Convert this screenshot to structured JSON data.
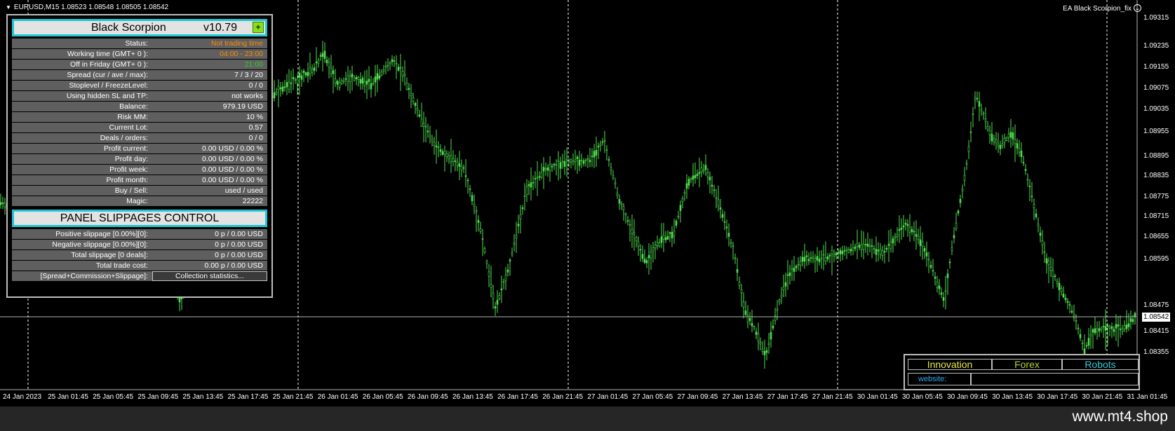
{
  "window": {
    "symbol_line": "EURUSD,M15  1.08523 1.08548 1.08505 1.08542",
    "ea_label": "EA Black Scorpion_fix",
    "smile_icon": "smile-icon"
  },
  "colors": {
    "candle": "#4fe04f",
    "grid": "#ffffff",
    "background": "#000000",
    "panel_accent": "#1fc6d6",
    "orange": "#ff8c00",
    "green": "#2fcf2f"
  },
  "chart": {
    "price_ticks": [
      "1.09315",
      "1.09235",
      "1.09155",
      "1.09075",
      "1.09035",
      "1.08955",
      "1.08895",
      "1.08835",
      "1.08775",
      "1.08715",
      "1.08655",
      "1.08595",
      "1.08542",
      "1.08475",
      "1.08415",
      "1.08355"
    ],
    "current_price": "1.08542",
    "time_ticks": [
      "24 Jan 2023",
      "25 Jan 01:45",
      "25 Jan 05:45",
      "25 Jan 09:45",
      "25 Jan 13:45",
      "25 Jan 17:45",
      "25 Jan 21:45",
      "26 Jan 01:45",
      "26 Jan 05:45",
      "26 Jan 09:45",
      "26 Jan 13:45",
      "26 Jan 17:45",
      "26 Jan 21:45",
      "27 Jan 01:45",
      "27 Jan 05:45",
      "27 Jan 09:45",
      "27 Jan 13:45",
      "27 Jan 17:45",
      "27 Jan 21:45",
      "30 Jan 01:45",
      "30 Jan 05:45",
      "30 Jan 09:45",
      "30 Jan 13:45",
      "30 Jan 17:45",
      "30 Jan 21:45",
      "31 Jan 01:45"
    ]
  },
  "panel": {
    "title": "Black Scorpion",
    "version": "v10.79",
    "rows": [
      {
        "label": "Status:",
        "value": "Not trading time",
        "color": "orange"
      },
      {
        "label": "Working time (GMT+ 0 ):",
        "value": "04:00 - 23:00",
        "color": "orange"
      },
      {
        "label": "Off in Friday (GMT+ 0 ):",
        "value": "21:00",
        "color": "green"
      },
      {
        "label": "Spread (cur / ave / max):",
        "value": "7 / 3 / 20",
        "color": ""
      },
      {
        "label": "Stoplevel  /  FreezeLevel:",
        "value": "0    /    0",
        "color": ""
      },
      {
        "label": "Using hidden SL and TP:",
        "value": "not works",
        "color": ""
      },
      {
        "label": "Balance:",
        "value": "979.19  USD",
        "color": ""
      },
      {
        "label": "Risk MM:",
        "value": "10 %",
        "color": ""
      },
      {
        "label": "Current Lot:",
        "value": "0.57",
        "color": ""
      },
      {
        "label": "Deals / orders:",
        "value": "0  /  0",
        "color": ""
      },
      {
        "label": "Profit current:",
        "value": "0.00 USD / 0.00 %",
        "color": ""
      },
      {
        "label": "Profit day:",
        "value": "0.00 USD / 0.00 %",
        "color": ""
      },
      {
        "label": "Profit week:",
        "value": "0.00 USD / 0.00 %",
        "color": ""
      },
      {
        "label": "Profit month:",
        "value": "0.00 USD / 0.00 %",
        "color": ""
      },
      {
        "label": "Buy / Sell:",
        "value": "used  /  used",
        "color": ""
      },
      {
        "label": "Magic:",
        "value": "22222",
        "color": ""
      }
    ],
    "slippage_title": "PANEL SLIPPAGES CONTROL",
    "slippage_rows": [
      {
        "label": "Positive slippage [0.00%][0]:",
        "value": "0 p / 0.00 USD"
      },
      {
        "label": "Negative slippage [0.00%][0]:",
        "value": "0 p / 0.00 USD"
      },
      {
        "label": "Total slippage [0 deals]:",
        "value": "0 p / 0.00 USD"
      },
      {
        "label": "Total trade cost:",
        "value": "0.00 p / 0.00 USD"
      }
    ],
    "stats_label": "[Spread+Commission+Slippage]:",
    "stats_button": "Collection statistics..."
  },
  "ad": {
    "innovation": "Innovation",
    "forex": "Forex",
    "robots": "Robots",
    "website": "website:"
  },
  "footer": {
    "site": "www.mt4.shop"
  }
}
